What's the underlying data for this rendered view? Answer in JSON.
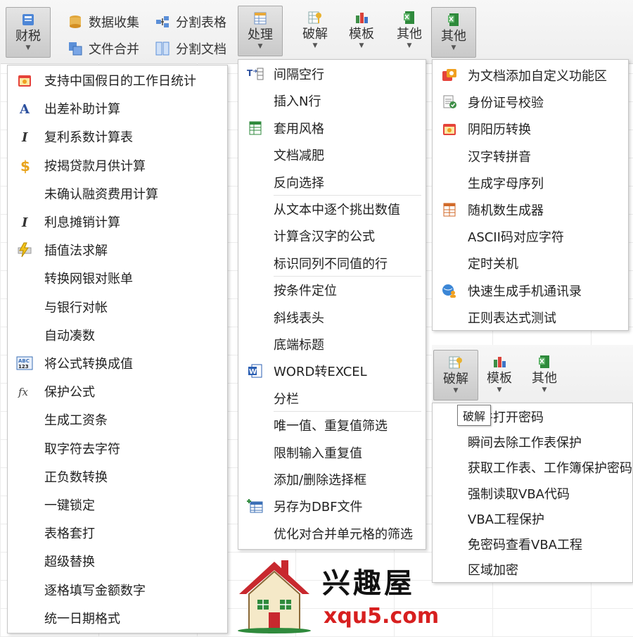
{
  "ribbon": {
    "caishui": {
      "label": "财税",
      "icon": "tax-icon"
    },
    "shuju_shouji": {
      "label": "数据收集",
      "icon": "database-icon"
    },
    "wenjian_hebing": {
      "label": "文件合并",
      "icon": "merge-files-icon"
    },
    "fenge_biaoge": {
      "label": "分割表格",
      "icon": "split-table-icon"
    },
    "fenge_wendang": {
      "label": "分割文档",
      "icon": "split-doc-icon"
    },
    "chuli": {
      "label": "处理",
      "icon": "process-icon"
    },
    "pojie": {
      "label": "破解",
      "icon": "crack-icon"
    },
    "moban": {
      "label": "模板",
      "icon": "template-icon"
    },
    "qita1": {
      "label": "其他",
      "icon": "other-icon"
    },
    "qita2": {
      "label": "其他",
      "icon": "other-icon"
    }
  },
  "menu_caishui": {
    "items": [
      {
        "label": "支持中国假日的工作日统计",
        "icon": "calendar-icon"
      },
      {
        "label": "出差补助计算",
        "icon": "letter-a-icon"
      },
      {
        "label": "复利系数计算表",
        "icon": "italic-i-icon"
      },
      {
        "label": "按揭贷款月供计算",
        "icon": "dollar-icon"
      },
      {
        "label": "未确认融资费用计算",
        "icon": ""
      },
      {
        "label": "利息摊销计算",
        "icon": "italic-i-icon"
      },
      {
        "label": "插值法求解",
        "icon": "lightning-icon"
      },
      {
        "label": "转换网银对账单",
        "icon": ""
      },
      {
        "label": "与银行对帐",
        "icon": ""
      },
      {
        "label": "自动凑数",
        "icon": ""
      },
      {
        "label": "将公式转换成值",
        "icon": "abc123-icon"
      },
      {
        "label": "保护公式",
        "icon": "fx-icon"
      },
      {
        "label": "生成工资条",
        "icon": ""
      },
      {
        "label": "取字符去字符",
        "icon": ""
      },
      {
        "label": "正负数转换",
        "icon": ""
      },
      {
        "label": "一键锁定",
        "icon": ""
      },
      {
        "label": "表格套打",
        "icon": ""
      },
      {
        "label": "超级替换",
        "icon": ""
      },
      {
        "label": "逐格填写金额数字",
        "icon": ""
      },
      {
        "label": "统一日期格式",
        "icon": ""
      }
    ]
  },
  "menu_chuli": {
    "items": [
      {
        "label": "间隔空行",
        "icon": "insert-row-icon"
      },
      {
        "label": "插入N行",
        "icon": ""
      },
      {
        "label": "套用风格",
        "icon": "table-style-icon"
      },
      {
        "label": "文档减肥",
        "icon": ""
      },
      {
        "label": "反向选择",
        "icon": ""
      },
      {
        "label": "从文本中逐个挑出数值",
        "icon": ""
      },
      {
        "label": "计算含汉字的公式",
        "icon": ""
      },
      {
        "label": "标识同列不同值的行",
        "icon": ""
      },
      {
        "label": "按条件定位",
        "icon": ""
      },
      {
        "label": "斜线表头",
        "icon": ""
      },
      {
        "label": "底端标题",
        "icon": ""
      },
      {
        "label": "WORD转EXCEL",
        "icon": "word-icon"
      },
      {
        "label": "分栏",
        "icon": ""
      },
      {
        "label": "唯一值、重复值筛选",
        "icon": ""
      },
      {
        "label": "限制输入重复值",
        "icon": ""
      },
      {
        "label": "添加/删除选择框",
        "icon": ""
      },
      {
        "label": "另存为DBF文件",
        "icon": "dbf-table-icon"
      },
      {
        "label": "优化对合并单元格的筛选",
        "icon": ""
      }
    ]
  },
  "menu_qita": {
    "items": [
      {
        "label": "为文档添加自定义功能区",
        "icon": "ribbon-custom-icon"
      },
      {
        "label": "身份证号校验",
        "icon": "id-check-icon"
      },
      {
        "label": "阴阳历转换",
        "icon": "calendar-icon"
      },
      {
        "label": "汉字转拼音",
        "icon": ""
      },
      {
        "label": "生成字母序列",
        "icon": ""
      },
      {
        "label": "随机数生成器",
        "icon": "random-icon"
      },
      {
        "label": "ASCII码对应字符",
        "icon": ""
      },
      {
        "label": "定时关机",
        "icon": ""
      },
      {
        "label": "快速生成手机通讯录",
        "icon": "globe-user-icon"
      },
      {
        "label": "正则表达式测试",
        "icon": ""
      }
    ]
  },
  "mini_ribbon": {
    "pojie": {
      "label": "破解"
    },
    "moban": {
      "label": "模板"
    },
    "qita": {
      "label": "其他"
    }
  },
  "tooltip": {
    "text": "破解"
  },
  "menu_pojie": {
    "items": [
      {
        "label": "文件打开密码"
      },
      {
        "label": "瞬间去除工作表保护"
      },
      {
        "label": "获取工作表、工作簿保护密码"
      },
      {
        "label": "强制读取VBA代码"
      },
      {
        "label": "VBA工程保护"
      },
      {
        "label": "免密码查看VBA工程"
      },
      {
        "label": "区域加密"
      }
    ]
  },
  "watermark": {
    "title": "兴趣屋",
    "url": "xqu5.com"
  },
  "colors": {
    "accent_red": "#d71f1f",
    "roof_red": "#c8282e",
    "house_green": "#2f8a3c"
  }
}
